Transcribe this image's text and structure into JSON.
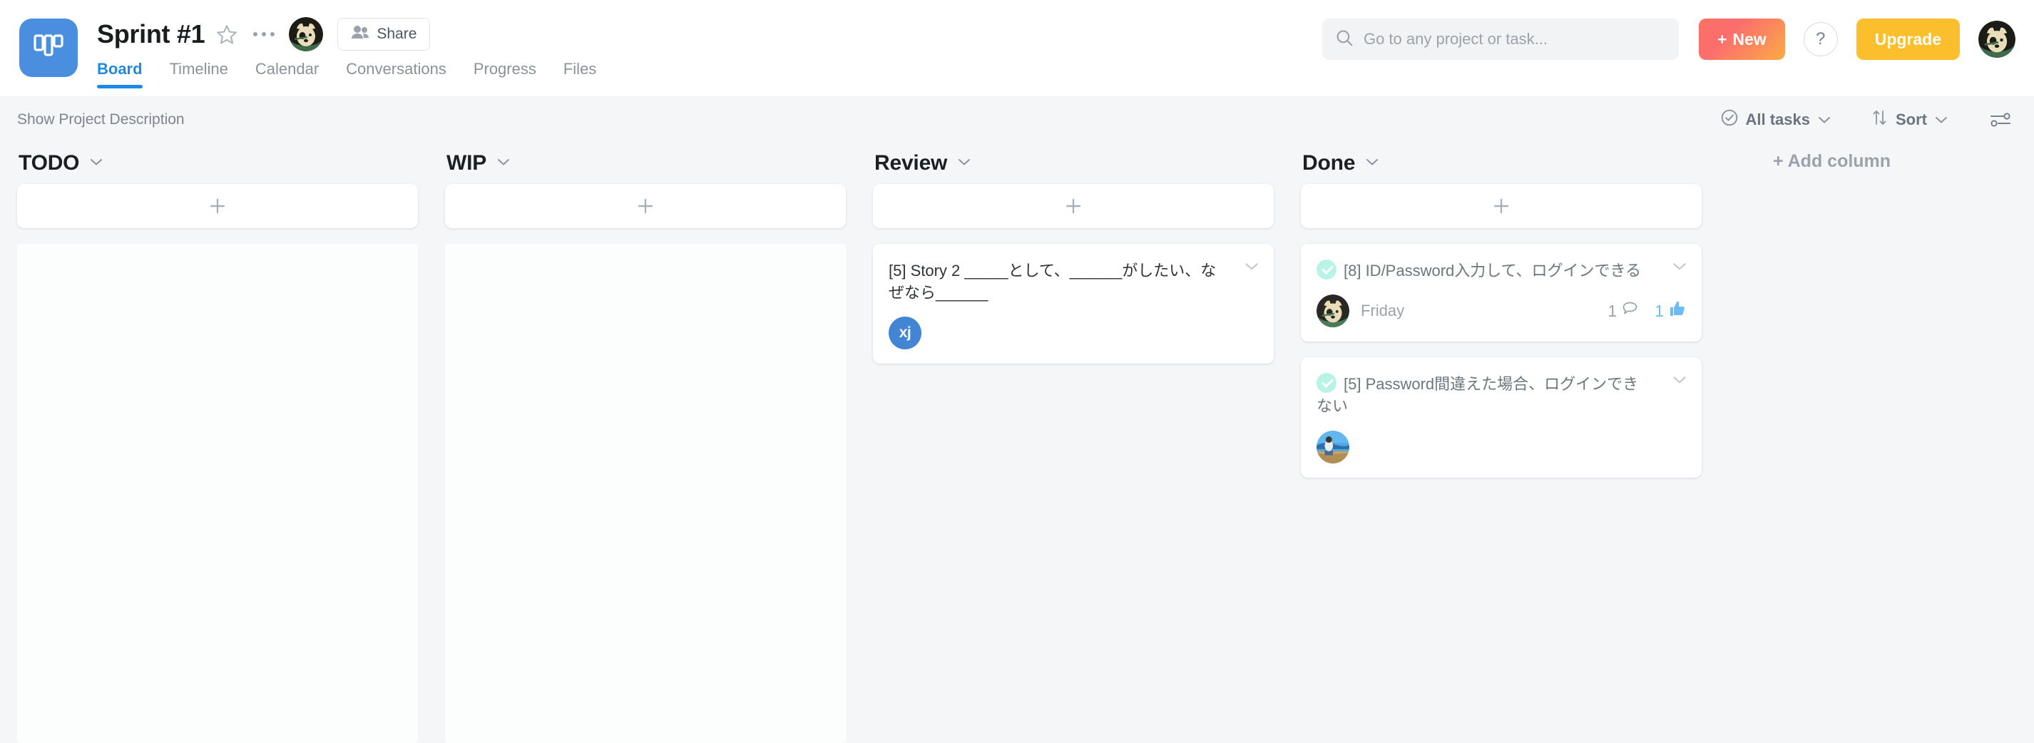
{
  "header": {
    "logo_icon": "board-logo-icon",
    "project_title": "Sprint #1",
    "star_icon": "star-icon",
    "more_icon": "more-options-icon",
    "owner_avatar_alt": "owner-avatar",
    "share_label": "Share",
    "share_icon": "people-icon",
    "tabs": [
      {
        "label": "Board",
        "active": true
      },
      {
        "label": "Timeline",
        "active": false
      },
      {
        "label": "Calendar",
        "active": false
      },
      {
        "label": "Conversations",
        "active": false
      },
      {
        "label": "Progress",
        "active": false
      },
      {
        "label": "Files",
        "active": false
      }
    ],
    "search": {
      "placeholder": "Go to any project or task...",
      "value": "",
      "icon": "search-icon"
    },
    "new_button": {
      "label": "New",
      "prefix": "+"
    },
    "help_button": {
      "label": "?"
    },
    "upgrade_button": {
      "label": "Upgrade"
    },
    "user_avatar_alt": "user-avatar"
  },
  "toolbar": {
    "show_description": "Show Project Description",
    "all_tasks": {
      "label": "All tasks",
      "icon": "check-circle-icon",
      "chevron": "chevron-down-icon"
    },
    "sort": {
      "label": "Sort",
      "icon": "sort-arrows-icon",
      "chevron": "chevron-down-icon"
    },
    "settings_icon": "sliders-icon"
  },
  "board": {
    "add_column_label": "+ Add column",
    "add_card_icon": "plus-icon",
    "columns": [
      {
        "title": "TODO",
        "chevron": "chevron-down-icon",
        "cards": []
      },
      {
        "title": "WIP",
        "chevron": "chevron-down-icon",
        "cards": []
      },
      {
        "title": "Review",
        "chevron": "chevron-down-icon",
        "cards": [
          {
            "title": "[5] Story 2 _____として、______がしたい、なぜなら______",
            "completed": false,
            "avatar_type": "initials",
            "avatar_initials": "xj",
            "assignee_name": "",
            "comments": "",
            "likes": ""
          }
        ]
      },
      {
        "title": "Done",
        "chevron": "chevron-down-icon",
        "cards": [
          {
            "title": "[8] ID/Password入力して、ログインできる",
            "completed": true,
            "avatar_type": "dog",
            "avatar_initials": "",
            "assignee_name": "Friday",
            "comments": "1",
            "likes": "1"
          },
          {
            "title": "[5] Password間違えた場合、ログインできない",
            "completed": true,
            "avatar_type": "photo",
            "avatar_initials": "",
            "assignee_name": "",
            "comments": "",
            "likes": ""
          }
        ]
      }
    ]
  },
  "colors": {
    "accent_blue": "#1e8ae8",
    "logo_blue": "#4a8ee0",
    "new_btn_coral": "#fb6d6d",
    "upgrade_yellow": "#fbbe2c",
    "done_check_teal": "#b9f3e6",
    "like_blue": "#6bbdf5",
    "page_bg": "#f4f6f8"
  }
}
